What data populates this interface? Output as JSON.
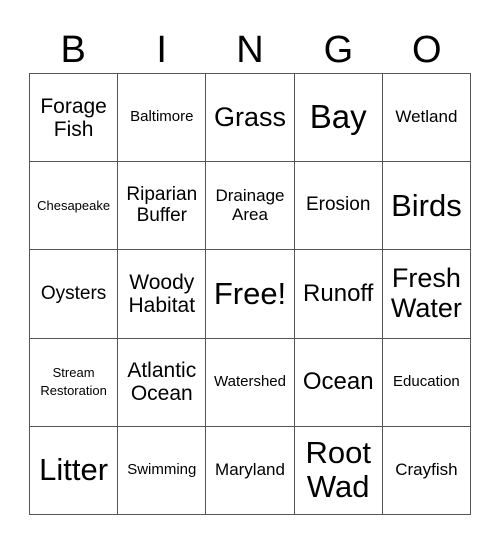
{
  "header": [
    "B",
    "I",
    "N",
    "G",
    "O"
  ],
  "cells": [
    {
      "text": "Forage Fish",
      "size": "s21"
    },
    {
      "text": "Baltimore",
      "size": "s15"
    },
    {
      "text": "Grass",
      "size": "s27"
    },
    {
      "text": "Bay",
      "size": "s33"
    },
    {
      "text": "Wetland",
      "size": "s17"
    },
    {
      "text": "Chesapeake",
      "size": "s13"
    },
    {
      "text": "Riparian Buffer",
      "size": "s19"
    },
    {
      "text": "Drainage Area",
      "size": "s17"
    },
    {
      "text": "Erosion",
      "size": "s19"
    },
    {
      "text": "Birds",
      "size": "s31"
    },
    {
      "text": "Oysters",
      "size": "s19"
    },
    {
      "text": "Woody Habitat",
      "size": "s21"
    },
    {
      "text": "Free!",
      "size": "s31"
    },
    {
      "text": "Runoff",
      "size": "s23"
    },
    {
      "text": "Fresh Water",
      "size": "s27"
    },
    {
      "text": "Stream Restoration",
      "size": "s13"
    },
    {
      "text": "Atlantic Ocean",
      "size": "s21"
    },
    {
      "text": "Watershed",
      "size": "s15"
    },
    {
      "text": "Ocean",
      "size": "s23"
    },
    {
      "text": "Education",
      "size": "s15"
    },
    {
      "text": "Litter",
      "size": "s31"
    },
    {
      "text": "Swimming",
      "size": "s15"
    },
    {
      "text": "Maryland",
      "size": "s17"
    },
    {
      "text": "Root Wad",
      "size": "s31"
    },
    {
      "text": "Crayfish",
      "size": "s17"
    }
  ]
}
